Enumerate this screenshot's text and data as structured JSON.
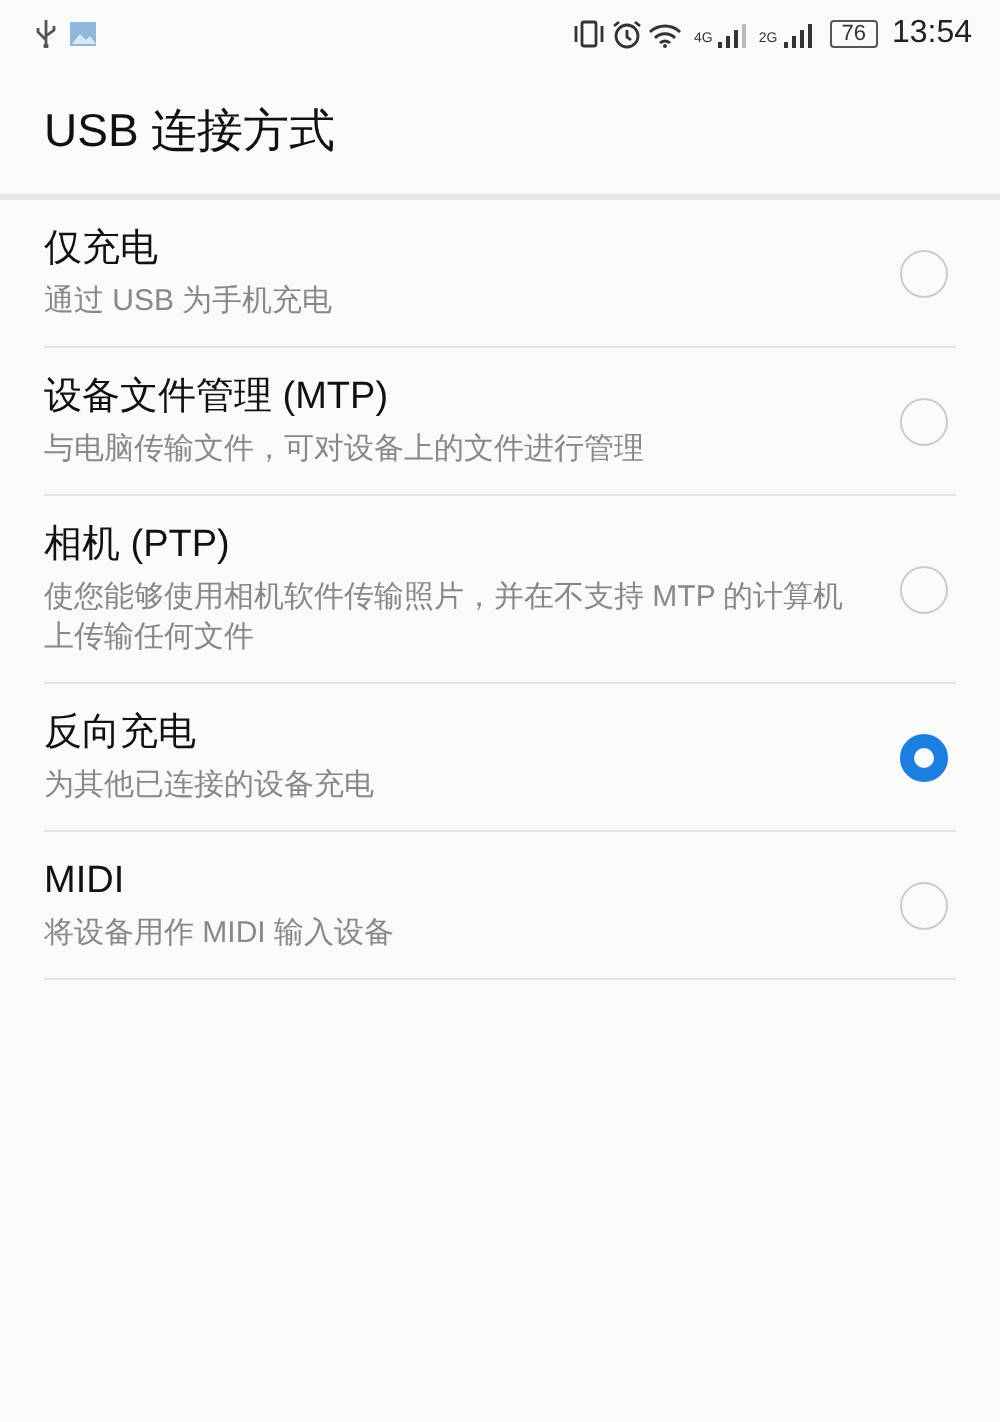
{
  "status_bar": {
    "network_1": "4G",
    "network_2": "2G",
    "battery": "76",
    "time": "13:54"
  },
  "title": "USB 连接方式",
  "options": [
    {
      "label": "仅充电",
      "description": "通过 USB 为手机充电",
      "selected": false
    },
    {
      "label": "设备文件管理 (MTP)",
      "description": "与电脑传输文件，可对设备上的文件进行管理",
      "selected": false
    },
    {
      "label": "相机 (PTP)",
      "description": "使您能够使用相机软件传输照片，并在不支持 MTP 的计算机上传输任何文件",
      "selected": false
    },
    {
      "label": "反向充电",
      "description": "为其他已连接的设备充电",
      "selected": true
    },
    {
      "label": "MIDI",
      "description": "将设备用作 MIDI 输入设备",
      "selected": false
    }
  ]
}
